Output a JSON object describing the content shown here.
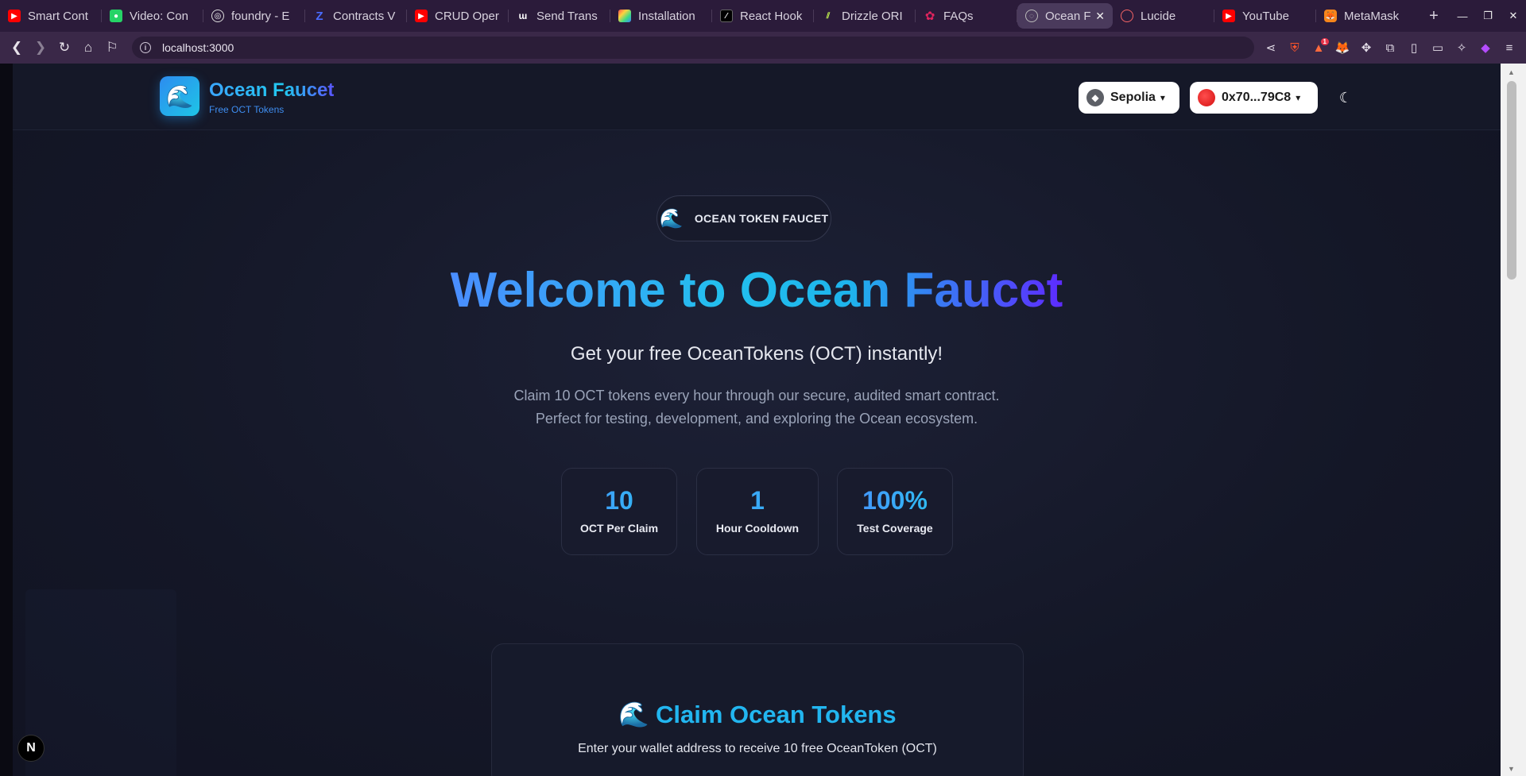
{
  "browser": {
    "tabs": [
      {
        "title": "Smart Cont",
        "icon": "youtube-icon",
        "color": "#ff0000"
      },
      {
        "title": "Video: Con",
        "icon": "chat-icon",
        "color": "#25d366"
      },
      {
        "title": "foundry - E",
        "icon": "foundry-icon",
        "color": "#888888"
      },
      {
        "title": "Contracts V",
        "icon": "z-icon",
        "color": "#4a6cff"
      },
      {
        "title": "CRUD Oper",
        "icon": "youtube-icon",
        "color": "#ff0000"
      },
      {
        "title": "Send Trans",
        "icon": "wagmi-icon",
        "color": "#ffffff"
      },
      {
        "title": "Installation",
        "icon": "rainbow-icon",
        "color": "#ff9f1c"
      },
      {
        "title": "React Hook",
        "icon": "react-hook-icon",
        "color": "#000000"
      },
      {
        "title": "Drizzle ORI",
        "icon": "drizzle-icon",
        "color": "#c5f74f"
      },
      {
        "title": "FAQs",
        "icon": "gear-icon",
        "color": "#e0245e"
      },
      {
        "title": "Ocean F",
        "icon": "globe-icon",
        "color": "#9aa0a6",
        "active": true
      },
      {
        "title": "Lucide",
        "icon": "lucide-icon",
        "color": "#f56565"
      },
      {
        "title": "YouTube",
        "icon": "youtube-icon",
        "color": "#ff0000"
      },
      {
        "title": "MetaMask",
        "icon": "metamask-icon",
        "color": "#f6851b"
      }
    ],
    "url": "localhost:3000",
    "notification_count": "1"
  },
  "header": {
    "brand_title": "Ocean Faucet",
    "brand_subtitle": "Free OCT Tokens",
    "network_label": "Sepolia",
    "account_label": "0x70...79C8"
  },
  "hero": {
    "pill_label": "OCEAN TOKEN FAUCET",
    "title": "Welcome to Ocean Faucet",
    "subtitle": "Get your free OceanTokens (OCT) instantly!",
    "description_line1": "Claim 10 OCT tokens every hour through our secure, audited smart contract.",
    "description_line2": "Perfect for testing, development, and exploring the Ocean ecosystem."
  },
  "stats": [
    {
      "value": "10",
      "label": "OCT Per Claim"
    },
    {
      "value": "1",
      "label": "Hour Cooldown"
    },
    {
      "value": "100%",
      "label": "Test Coverage"
    }
  ],
  "claim": {
    "title": "Claim Ocean Tokens",
    "description": "Enter your wallet address to receive 10 free OceanToken (OCT)"
  },
  "colors": {
    "accent_blue": "#22b6f0",
    "accent_purple": "#5d2bff",
    "background": "#141727"
  }
}
